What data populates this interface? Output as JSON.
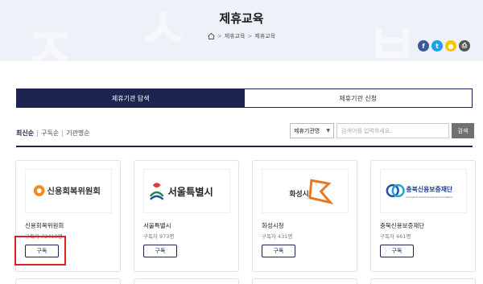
{
  "page": {
    "title": "제휴교육",
    "breadcrumb": [
      "제휴교육",
      "제휴교육"
    ]
  },
  "share": [
    {
      "icon": "facebook-icon",
      "glyph": "f",
      "color": "#3b5998"
    },
    {
      "icon": "twitter-icon",
      "glyph": "t",
      "color": "#1da1f2"
    },
    {
      "icon": "kakao-icon",
      "glyph": "●",
      "color": "#f7c600"
    },
    {
      "icon": "print-icon",
      "glyph": "⎙",
      "color": "#555555"
    }
  ],
  "tabs": [
    {
      "label": "제휴기관 탐색",
      "active": true
    },
    {
      "label": "제휴기관 신청",
      "active": false
    }
  ],
  "sorts": [
    "최신순",
    "구독순",
    "기관명순"
  ],
  "search": {
    "select_value": "제휴기관명",
    "placeholder": "검색어를 입력하세요.",
    "button": "검색"
  },
  "cards": [
    {
      "name": "신용회복위원회",
      "subs": "구독자 72410명",
      "button": "구독",
      "logo_text": "신용회복위원회"
    },
    {
      "name": "서울특별시",
      "subs": "구독자 973명",
      "button": "구독",
      "logo_text": "서울특별시"
    },
    {
      "name": "화성시청",
      "subs": "구독자 431명",
      "button": "구독",
      "logo_text": "화성시"
    },
    {
      "name": "충북신용보증재단",
      "subs": "구독자 461명",
      "button": "구독",
      "logo_text": "충북신용보증재단",
      "logo_sub": "Chungbuk Credit Guarantee Foundation"
    }
  ],
  "colors": {
    "navy": "#1b2550",
    "highlight": "#e02020"
  }
}
